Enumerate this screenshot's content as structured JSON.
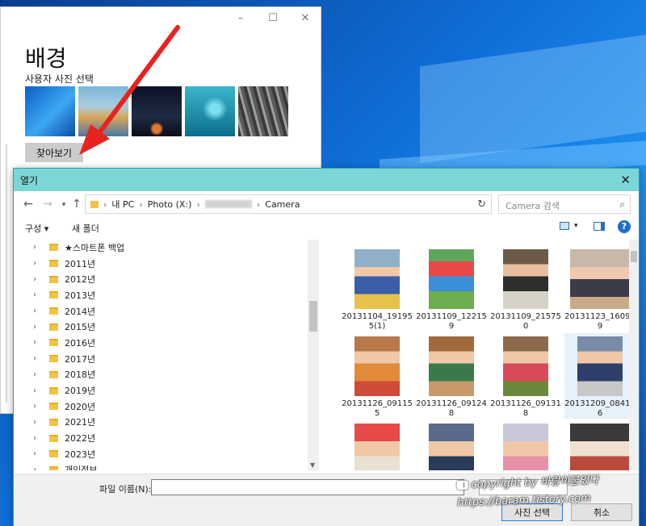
{
  "settings": {
    "title": "배경",
    "subtitle": "사용자 사진 선택",
    "browse_label": "찾아보기",
    "window_controls": [
      "minimize-icon",
      "maximize-icon",
      "close-icon"
    ]
  },
  "dialog": {
    "title": "열기",
    "breadcrumb": [
      "내 PC",
      "Photo (X:)",
      "Camera"
    ],
    "search_placeholder": "Camera 검색",
    "toolbar": {
      "organize": "구성 ▾",
      "new_folder": "새 폴더"
    },
    "tree_items": [
      "★스마트폰 백업",
      "2011년",
      "2012년",
      "2013년",
      "2014년",
      "2015년",
      "2016년",
      "2017년",
      "2018년",
      "2019년",
      "2020년",
      "2021년",
      "2022년",
      "2023년",
      "개인정보"
    ],
    "files": [
      {
        "name": "20131104_191955(1)"
      },
      {
        "name": "20131109_122159"
      },
      {
        "name": "20131109_215750"
      },
      {
        "name": "20131123_160929"
      },
      {
        "name": "20131126_091155"
      },
      {
        "name": "20131126_091248"
      },
      {
        "name": "20131126_091318"
      },
      {
        "name": "20131209_084106",
        "selected": true
      },
      {
        "name": ""
      },
      {
        "name": ""
      },
      {
        "name": ""
      },
      {
        "name": ""
      }
    ],
    "filename_label": "파일 이름(N):",
    "filename_value": "",
    "filetype_label": "",
    "open_label": "사진 선택",
    "cancel_label": "취소"
  },
  "watermark": {
    "line1": "copyright by 바람이불었다",
    "line2": "https://baram.tistory.com"
  },
  "colors": {
    "dialog_titlebar": "#7cd6d6",
    "arrow": "#e8231f",
    "desktop": "#0f6fd8"
  }
}
